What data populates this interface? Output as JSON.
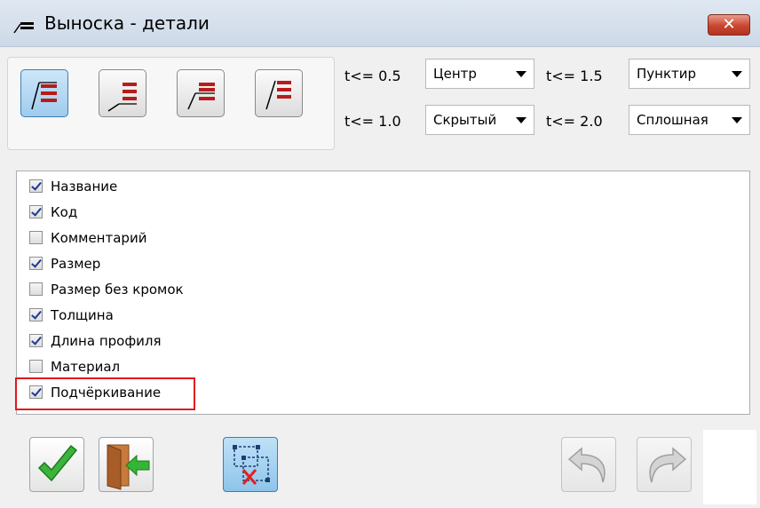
{
  "window": {
    "title": "Выноска - детали",
    "close_icon": "close-x",
    "title_icon": "leader-icon"
  },
  "style_buttons": [
    {
      "name": "leader-style-1",
      "active": true
    },
    {
      "name": "leader-style-2",
      "active": false
    },
    {
      "name": "leader-style-3",
      "active": false
    },
    {
      "name": "leader-style-4",
      "active": false
    }
  ],
  "line_types": {
    "row1": {
      "t1_label": "t<= 0.5",
      "t1_value": "Центр",
      "t2_label": "t<= 1.5",
      "t2_value": "Пунктир"
    },
    "row2": {
      "t1_label": "t<= 1.0",
      "t1_value": "Скрытый",
      "t2_label": "t<= 2.0",
      "t2_value": "Сплошная"
    }
  },
  "fields": [
    {
      "label": "Название",
      "checked": true
    },
    {
      "label": "Код",
      "checked": true
    },
    {
      "label": "Комментарий",
      "checked": false
    },
    {
      "label": "Размер",
      "checked": true
    },
    {
      "label": "Размер без кромок",
      "checked": false
    },
    {
      "label": "Толщина",
      "checked": true
    },
    {
      "label": "Длина профиля",
      "checked": true
    },
    {
      "label": "Материал",
      "checked": false
    },
    {
      "label": "Подчёркивание",
      "checked": true
    }
  ],
  "bottom_toolbar": {
    "ok_icon": "checkmark-icon",
    "exit_icon": "exit-door-icon",
    "layout_icon": "grid-select-icon",
    "undo_icon": "undo-icon",
    "redo_icon": "redo-icon"
  },
  "colors": {
    "accent": "#c0392b",
    "highlight_border": "#e0181c",
    "ok_green": "#2ea12e"
  }
}
